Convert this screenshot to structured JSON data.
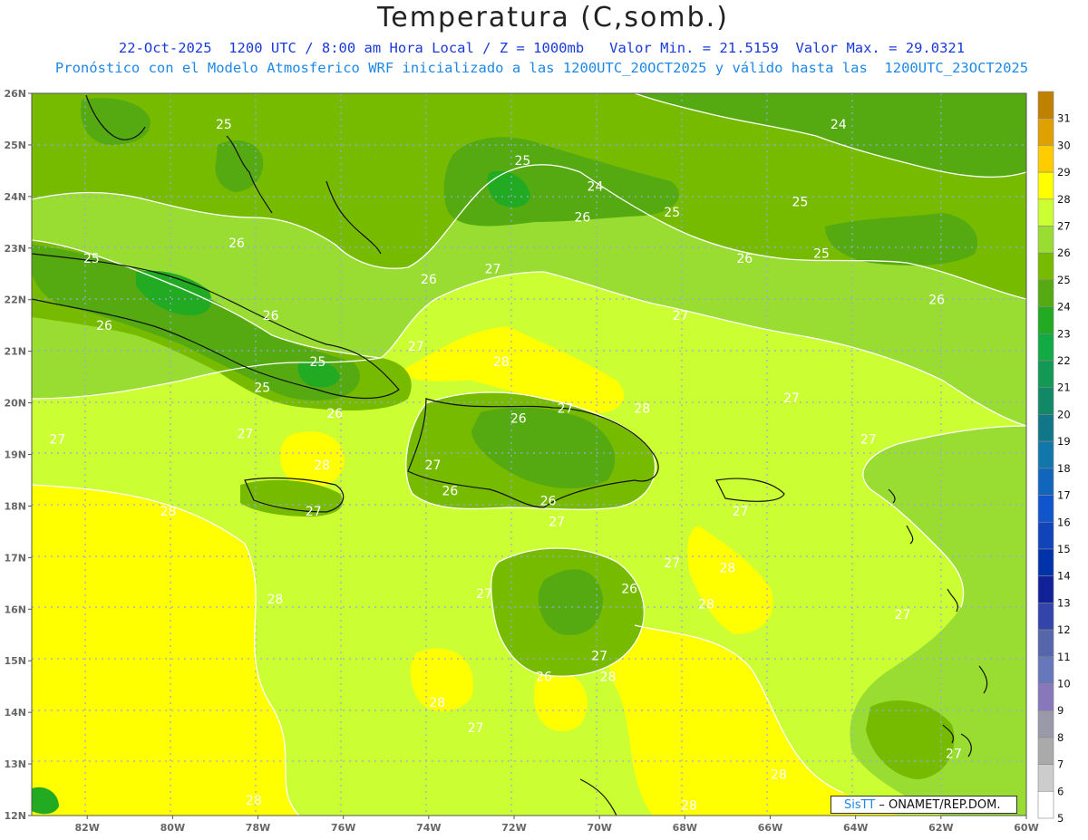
{
  "header": {
    "title": "Temperatura (C,somb.)",
    "subtitle_line1": "22-Oct-2025  1200 UTC / 8:00 am Hora Local / Z = 1000mb   Valor Min. = 21.5159  Valor Max. = 29.0321",
    "subtitle_line2": "Pronóstico con el Modelo Atmosferico WRF inicializado a las 1200UTC_20OCT2025 y válido hasta las  1200UTC_23OCT2025"
  },
  "axes": {
    "lat_labels": [
      "26N",
      "25N",
      "24N",
      "23N",
      "22N",
      "21N",
      "20N",
      "19N",
      "18N",
      "17N",
      "16N",
      "15N",
      "14N",
      "13N",
      "12N"
    ],
    "lon_labels": [
      "82W",
      "80W",
      "78W",
      "76W",
      "74W",
      "72W",
      "70W",
      "68W",
      "66W",
      "64W",
      "62W",
      "60W"
    ],
    "lat_range": [
      12,
      26
    ],
    "lon_range": [
      -83.3,
      -60
    ],
    "grid": "dotted"
  },
  "colorbar": {
    "levels": [
      31,
      30,
      29,
      28,
      27,
      26,
      25,
      24,
      23,
      22,
      21,
      20,
      19,
      18,
      17,
      16,
      15,
      14,
      13,
      12,
      11,
      10,
      9,
      8,
      7,
      6,
      5
    ],
    "colors": [
      "#c08000",
      "#e0a000",
      "#ffcc00",
      "#ffff00",
      "#ccff33",
      "#99dd33",
      "#77bb00",
      "#55aa11",
      "#22aa22",
      "#11aa44",
      "#119955",
      "#118866",
      "#117788",
      "#1177aa",
      "#1166bb",
      "#1155cc",
      "#1144bb",
      "#0033aa",
      "#112299",
      "#3344aa",
      "#5566aa",
      "#6677bb",
      "#8877bb",
      "#9999aa",
      "#aaaaaa",
      "#cccccc",
      "#ffffff"
    ]
  },
  "contour_labels": [
    {
      "text": "25",
      "lon": -78.8,
      "lat": 25.4
    },
    {
      "text": "24",
      "lon": -64.4,
      "lat": 25.4
    },
    {
      "text": "25",
      "lon": -71.8,
      "lat": 24.7
    },
    {
      "text": "24",
      "lon": -70.1,
      "lat": 24.2
    },
    {
      "text": "25",
      "lon": -68.3,
      "lat": 23.7
    },
    {
      "text": "25",
      "lon": -65.3,
      "lat": 23.9
    },
    {
      "text": "26",
      "lon": -70.4,
      "lat": 23.6
    },
    {
      "text": "26",
      "lon": -78.5,
      "lat": 23.1
    },
    {
      "text": "25",
      "lon": -81.9,
      "lat": 22.8
    },
    {
      "text": "27",
      "lon": -72.5,
      "lat": 22.6
    },
    {
      "text": "26",
      "lon": -66.6,
      "lat": 22.8
    },
    {
      "text": "25",
      "lon": -64.8,
      "lat": 22.9
    },
    {
      "text": "26",
      "lon": -74.0,
      "lat": 22.4
    },
    {
      "text": "26",
      "lon": -62.1,
      "lat": 22.0
    },
    {
      "text": "26",
      "lon": -77.7,
      "lat": 21.7
    },
    {
      "text": "26",
      "lon": -81.6,
      "lat": 21.5
    },
    {
      "text": "27",
      "lon": -68.1,
      "lat": 21.7
    },
    {
      "text": "27",
      "lon": -74.3,
      "lat": 21.1
    },
    {
      "text": "28",
      "lon": -72.3,
      "lat": 20.8
    },
    {
      "text": "25",
      "lon": -76.6,
      "lat": 20.8
    },
    {
      "text": "25",
      "lon": -77.9,
      "lat": 20.3
    },
    {
      "text": "27",
      "lon": -70.8,
      "lat": 19.9
    },
    {
      "text": "28",
      "lon": -69.0,
      "lat": 19.9
    },
    {
      "text": "26",
      "lon": -71.9,
      "lat": 19.7
    },
    {
      "text": "26",
      "lon": -76.2,
      "lat": 19.8
    },
    {
      "text": "27",
      "lon": -65.5,
      "lat": 20.1
    },
    {
      "text": "27",
      "lon": -82.7,
      "lat": 19.3
    },
    {
      "text": "27",
      "lon": -78.3,
      "lat": 19.4
    },
    {
      "text": "27",
      "lon": -63.7,
      "lat": 19.3
    },
    {
      "text": "28",
      "lon": -76.5,
      "lat": 18.8
    },
    {
      "text": "27",
      "lon": -73.9,
      "lat": 18.8
    },
    {
      "text": "26",
      "lon": -73.5,
      "lat": 18.3
    },
    {
      "text": "26",
      "lon": -71.2,
      "lat": 18.1
    },
    {
      "text": "27",
      "lon": -76.7,
      "lat": 17.9
    },
    {
      "text": "28",
      "lon": -80.1,
      "lat": 17.9
    },
    {
      "text": "27",
      "lon": -66.7,
      "lat": 17.9
    },
    {
      "text": "27",
      "lon": -71.0,
      "lat": 17.7
    },
    {
      "text": "27",
      "lon": -68.3,
      "lat": 16.9
    },
    {
      "text": "28",
      "lon": -67.0,
      "lat": 16.8
    },
    {
      "text": "26",
      "lon": -69.3,
      "lat": 16.4
    },
    {
      "text": "27",
      "lon": -72.7,
      "lat": 16.3
    },
    {
      "text": "28",
      "lon": -67.5,
      "lat": 16.1
    },
    {
      "text": "28",
      "lon": -77.6,
      "lat": 16.2
    },
    {
      "text": "27",
      "lon": -62.9,
      "lat": 15.9
    },
    {
      "text": "27",
      "lon": -70.0,
      "lat": 15.1
    },
    {
      "text": "26",
      "lon": -71.3,
      "lat": 14.7
    },
    {
      "text": "28",
      "lon": -69.8,
      "lat": 14.7
    },
    {
      "text": "28",
      "lon": -73.8,
      "lat": 14.2
    },
    {
      "text": "27",
      "lon": -72.9,
      "lat": 13.7
    },
    {
      "text": "27",
      "lon": -61.7,
      "lat": 13.2
    },
    {
      "text": "28",
      "lon": -65.8,
      "lat": 12.8
    },
    {
      "text": "28",
      "lon": -78.1,
      "lat": 12.3
    },
    {
      "text": "28",
      "lon": -67.9,
      "lat": 12.2
    }
  ],
  "credit": {
    "brand": "SisTT",
    "text": " – ONAMET/REP.DOM."
  }
}
